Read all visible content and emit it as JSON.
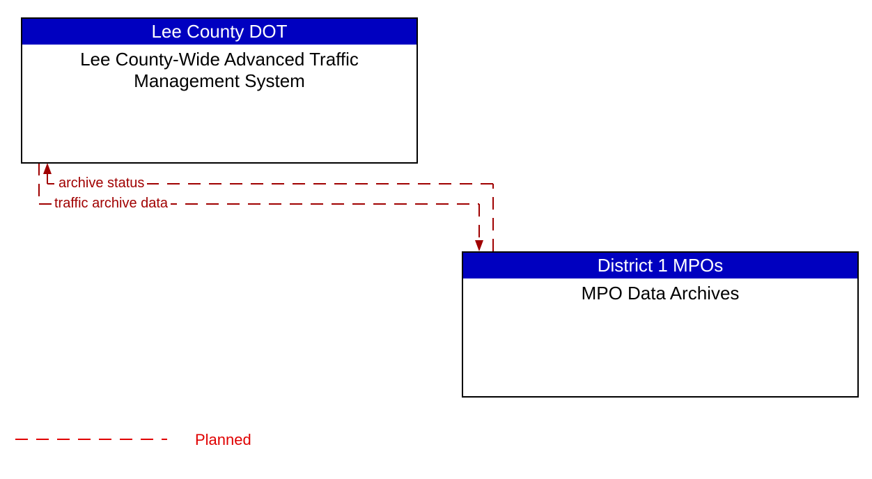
{
  "entities": {
    "topLeft": {
      "header": "Lee County DOT",
      "body": "Lee County-Wide Advanced Traffic Management System"
    },
    "bottomRight": {
      "header": "District 1 MPOs",
      "body": "MPO Data Archives"
    }
  },
  "flows": {
    "archiveStatus": "archive status",
    "trafficArchiveData": "traffic archive data"
  },
  "legend": {
    "planned": "Planned"
  }
}
